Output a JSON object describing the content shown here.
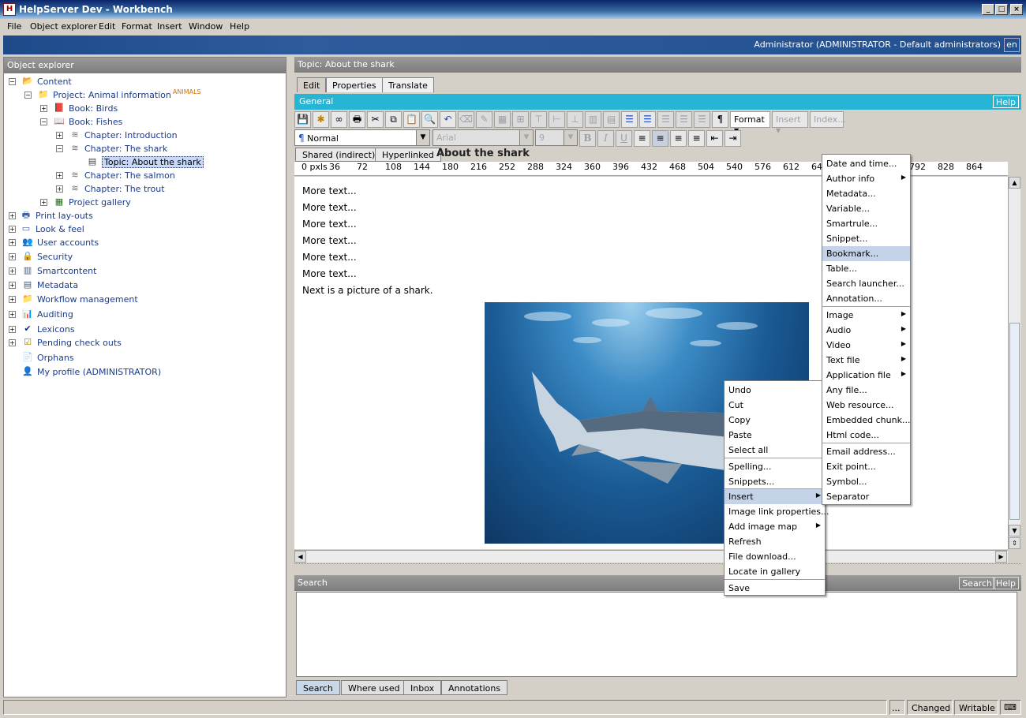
{
  "window": {
    "title": "HelpServer Dev - Workbench",
    "app_icon": "H"
  },
  "menu": [
    "File",
    "Object explorer",
    "Edit",
    "Format",
    "Insert",
    "Window",
    "Help"
  ],
  "banner": {
    "user": "Administrator (ADMINISTRATOR - Default administrators)",
    "lang": "en"
  },
  "explorer": {
    "title": "Object explorer",
    "nodes": {
      "content": "Content",
      "project": "Project: Animal information",
      "project_tag": "ANIMALS",
      "book_birds": "Book: Birds",
      "book_fishes": "Book: Fishes",
      "ch_intro": "Chapter: Introduction",
      "ch_shark": "Chapter: The shark",
      "topic_shark": "Topic: About the shark",
      "ch_salmon": "Chapter: The salmon",
      "ch_trout": "Chapter: The trout",
      "gallery": "Project gallery",
      "print": "Print lay-outs",
      "look": "Look & feel",
      "users": "User accounts",
      "security": "Security",
      "smart": "Smartcontent",
      "metadata": "Metadata",
      "workflow": "Workflow management",
      "auditing": "Auditing",
      "lexicons": "Lexicons",
      "pending": "Pending check outs",
      "orphans": "Orphans",
      "profile": "My profile (ADMINISTRATOR)"
    }
  },
  "topic": {
    "header": "Topic: About the shark",
    "tabs": {
      "edit": "Edit",
      "properties": "Properties",
      "translate": "Translate"
    },
    "general": "General",
    "help": "Help",
    "toolbar": {
      "format": "Format",
      "insert": "Insert",
      "index": "Index..."
    },
    "style": "Normal",
    "font": "Arial",
    "size": "9",
    "subtabs": {
      "shared": "Shared (indirect)",
      "hyperlinked": "Hyperlinked"
    },
    "doc_title": "About the shark",
    "ruler": {
      "unit": "0 pxls",
      "marks": [
        "36",
        "72",
        "108",
        "144",
        "180",
        "216",
        "252",
        "288",
        "324",
        "360",
        "396",
        "432",
        "468",
        "504",
        "540",
        "576",
        "612",
        "64",
        "792",
        "828",
        "864"
      ]
    },
    "lines": [
      "More text...",
      "More text...",
      "More text...",
      "More text...",
      "More text...",
      "More text...",
      "Next is a picture of a shark."
    ]
  },
  "search": {
    "title": "Search",
    "search_btn": "Search",
    "help_btn": "Help"
  },
  "bottom_tabs": {
    "search": "Search",
    "where_used": "Where used",
    "inbox": "Inbox",
    "annotations": "Annotations"
  },
  "status": {
    "dots": "...",
    "changed": "Changed",
    "writable": "Writable"
  },
  "context_menu": {
    "undo": "Undo",
    "cut": "Cut",
    "copy": "Copy",
    "paste": "Paste",
    "select_all": "Select all",
    "spelling": "Spelling...",
    "snippets": "Snippets...",
    "insert": "Insert",
    "image_link": "Image link properties...",
    "image_map": "Add image map",
    "refresh": "Refresh",
    "file_download": "File download...",
    "locate": "Locate in gallery",
    "save": "Save"
  },
  "insert_menu": {
    "date": "Date and time...",
    "author": "Author info",
    "metadata": "Metadata...",
    "variable": "Variable...",
    "smartrule": "Smartrule...",
    "snippet": "Snippet...",
    "bookmark": "Bookmark...",
    "table": "Table...",
    "search_launcher": "Search launcher...",
    "annotation": "Annotation...",
    "image": "Image",
    "audio": "Audio",
    "video": "Video",
    "text_file": "Text file",
    "app_file": "Application file",
    "any_file": "Any file...",
    "web_resource": "Web resource...",
    "embedded": "Embedded chunk...",
    "html": "Html code...",
    "email": "Email address...",
    "exit_point": "Exit point...",
    "symbol": "Symbol...",
    "separator": "Separator"
  }
}
